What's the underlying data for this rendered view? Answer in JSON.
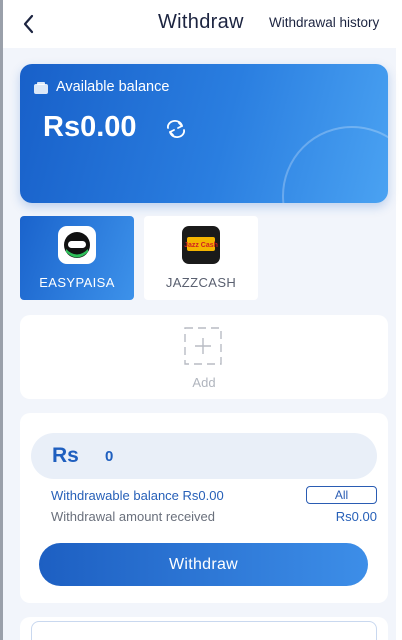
{
  "header": {
    "title": "Withdraw",
    "history_link": "Withdrawal history"
  },
  "balance": {
    "label": "Available balance",
    "amount": "Rs0.00"
  },
  "methods": [
    {
      "label": "EASYPAISA",
      "selected": true,
      "logo_text": ""
    },
    {
      "label": "JAZZCASH",
      "selected": false,
      "logo_text": "Jazz Cash"
    }
  ],
  "add_card": {
    "label": "Add"
  },
  "form": {
    "currency": "Rs",
    "amount_placeholder": "0",
    "withdrawable_label": "Withdrawable balance Rs0.00",
    "all_button": "All",
    "received_label": "Withdrawal amount received",
    "received_value": "Rs0.00",
    "submit_label": "Withdraw"
  },
  "colors": {
    "primary": "#1f5fbf",
    "accent_gradient_end": "#4aa2f2",
    "page_background": "#f2f5fb"
  },
  "icons": {
    "back": "chevron-left-icon",
    "wallet": "wallet-icon",
    "refresh": "refresh-icon",
    "add": "plus-icon"
  }
}
